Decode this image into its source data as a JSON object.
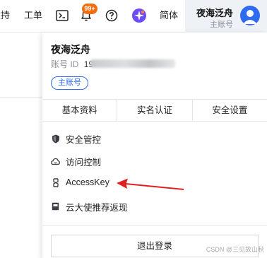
{
  "topbar": {
    "support_label": "支持",
    "ticket_label": "工单",
    "notification_badge": "99+",
    "lang_label": "简体",
    "user": {
      "name": "夜海泛舟",
      "account_type": "主账号"
    }
  },
  "panel": {
    "name": "夜海泛舟",
    "id_label": "账号 ID",
    "id_visible_prefix": "19",
    "main_tag": "主账号",
    "tabs": [
      {
        "label": "基本资料"
      },
      {
        "label": "实名认证"
      },
      {
        "label": "安全设置"
      }
    ],
    "menu": [
      {
        "label": "安全管控",
        "icon": "shield-icon"
      },
      {
        "label": "访问控制",
        "icon": "cloud-icon"
      },
      {
        "label": "AccessKey",
        "icon": "key-icon"
      },
      {
        "label": "云大使推荐返现",
        "icon": "book-icon"
      }
    ],
    "logout_label": "退出登录"
  },
  "annotation": {
    "arrow_color": "#e02020"
  },
  "watermark": "CSDN @三见故山秋",
  "colors": {
    "accent": "#2e6bf0",
    "badge": "#f26d0f",
    "user_area_bg": "#eef1f6"
  }
}
